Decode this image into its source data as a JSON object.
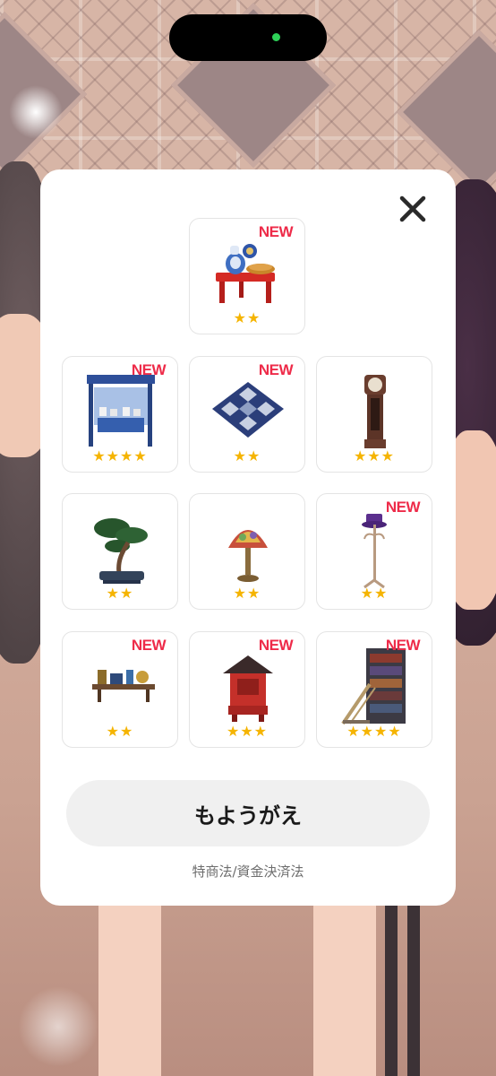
{
  "modal": {
    "close_icon": "close-icon",
    "items": [
      {
        "name": "tea-set-table",
        "is_new": true,
        "new_label": "NEW",
        "rarity": 2,
        "stars": "★★"
      },
      {
        "name": "blue-shop-stall",
        "is_new": true,
        "new_label": "NEW",
        "rarity": 4,
        "stars": "★★★★"
      },
      {
        "name": "checkered-rug",
        "is_new": true,
        "new_label": "NEW",
        "rarity": 2,
        "stars": "★★"
      },
      {
        "name": "grandfather-clock",
        "is_new": false,
        "new_label": "",
        "rarity": 3,
        "stars": "★★★"
      },
      {
        "name": "bonsai-tree",
        "is_new": false,
        "new_label": "",
        "rarity": 2,
        "stars": "★★"
      },
      {
        "name": "stained-glass-lamp",
        "is_new": false,
        "new_label": "",
        "rarity": 2,
        "stars": "★★"
      },
      {
        "name": "hat-coat-rack",
        "is_new": true,
        "new_label": "NEW",
        "rarity": 2,
        "stars": "★★"
      },
      {
        "name": "wall-shelf",
        "is_new": true,
        "new_label": "NEW",
        "rarity": 2,
        "stars": "★★"
      },
      {
        "name": "red-shrine",
        "is_new": true,
        "new_label": "NEW",
        "rarity": 3,
        "stars": "★★★"
      },
      {
        "name": "tall-bookshelf",
        "is_new": true,
        "new_label": "NEW",
        "rarity": 4,
        "stars": "★★★★"
      }
    ],
    "primary_button_label": "もようがえ",
    "legal_link_label": "特商法/資金決済法"
  },
  "colors": {
    "new_badge": "#ee2b49",
    "star": "#f5b400",
    "notch_indicator": "#2ed158"
  }
}
